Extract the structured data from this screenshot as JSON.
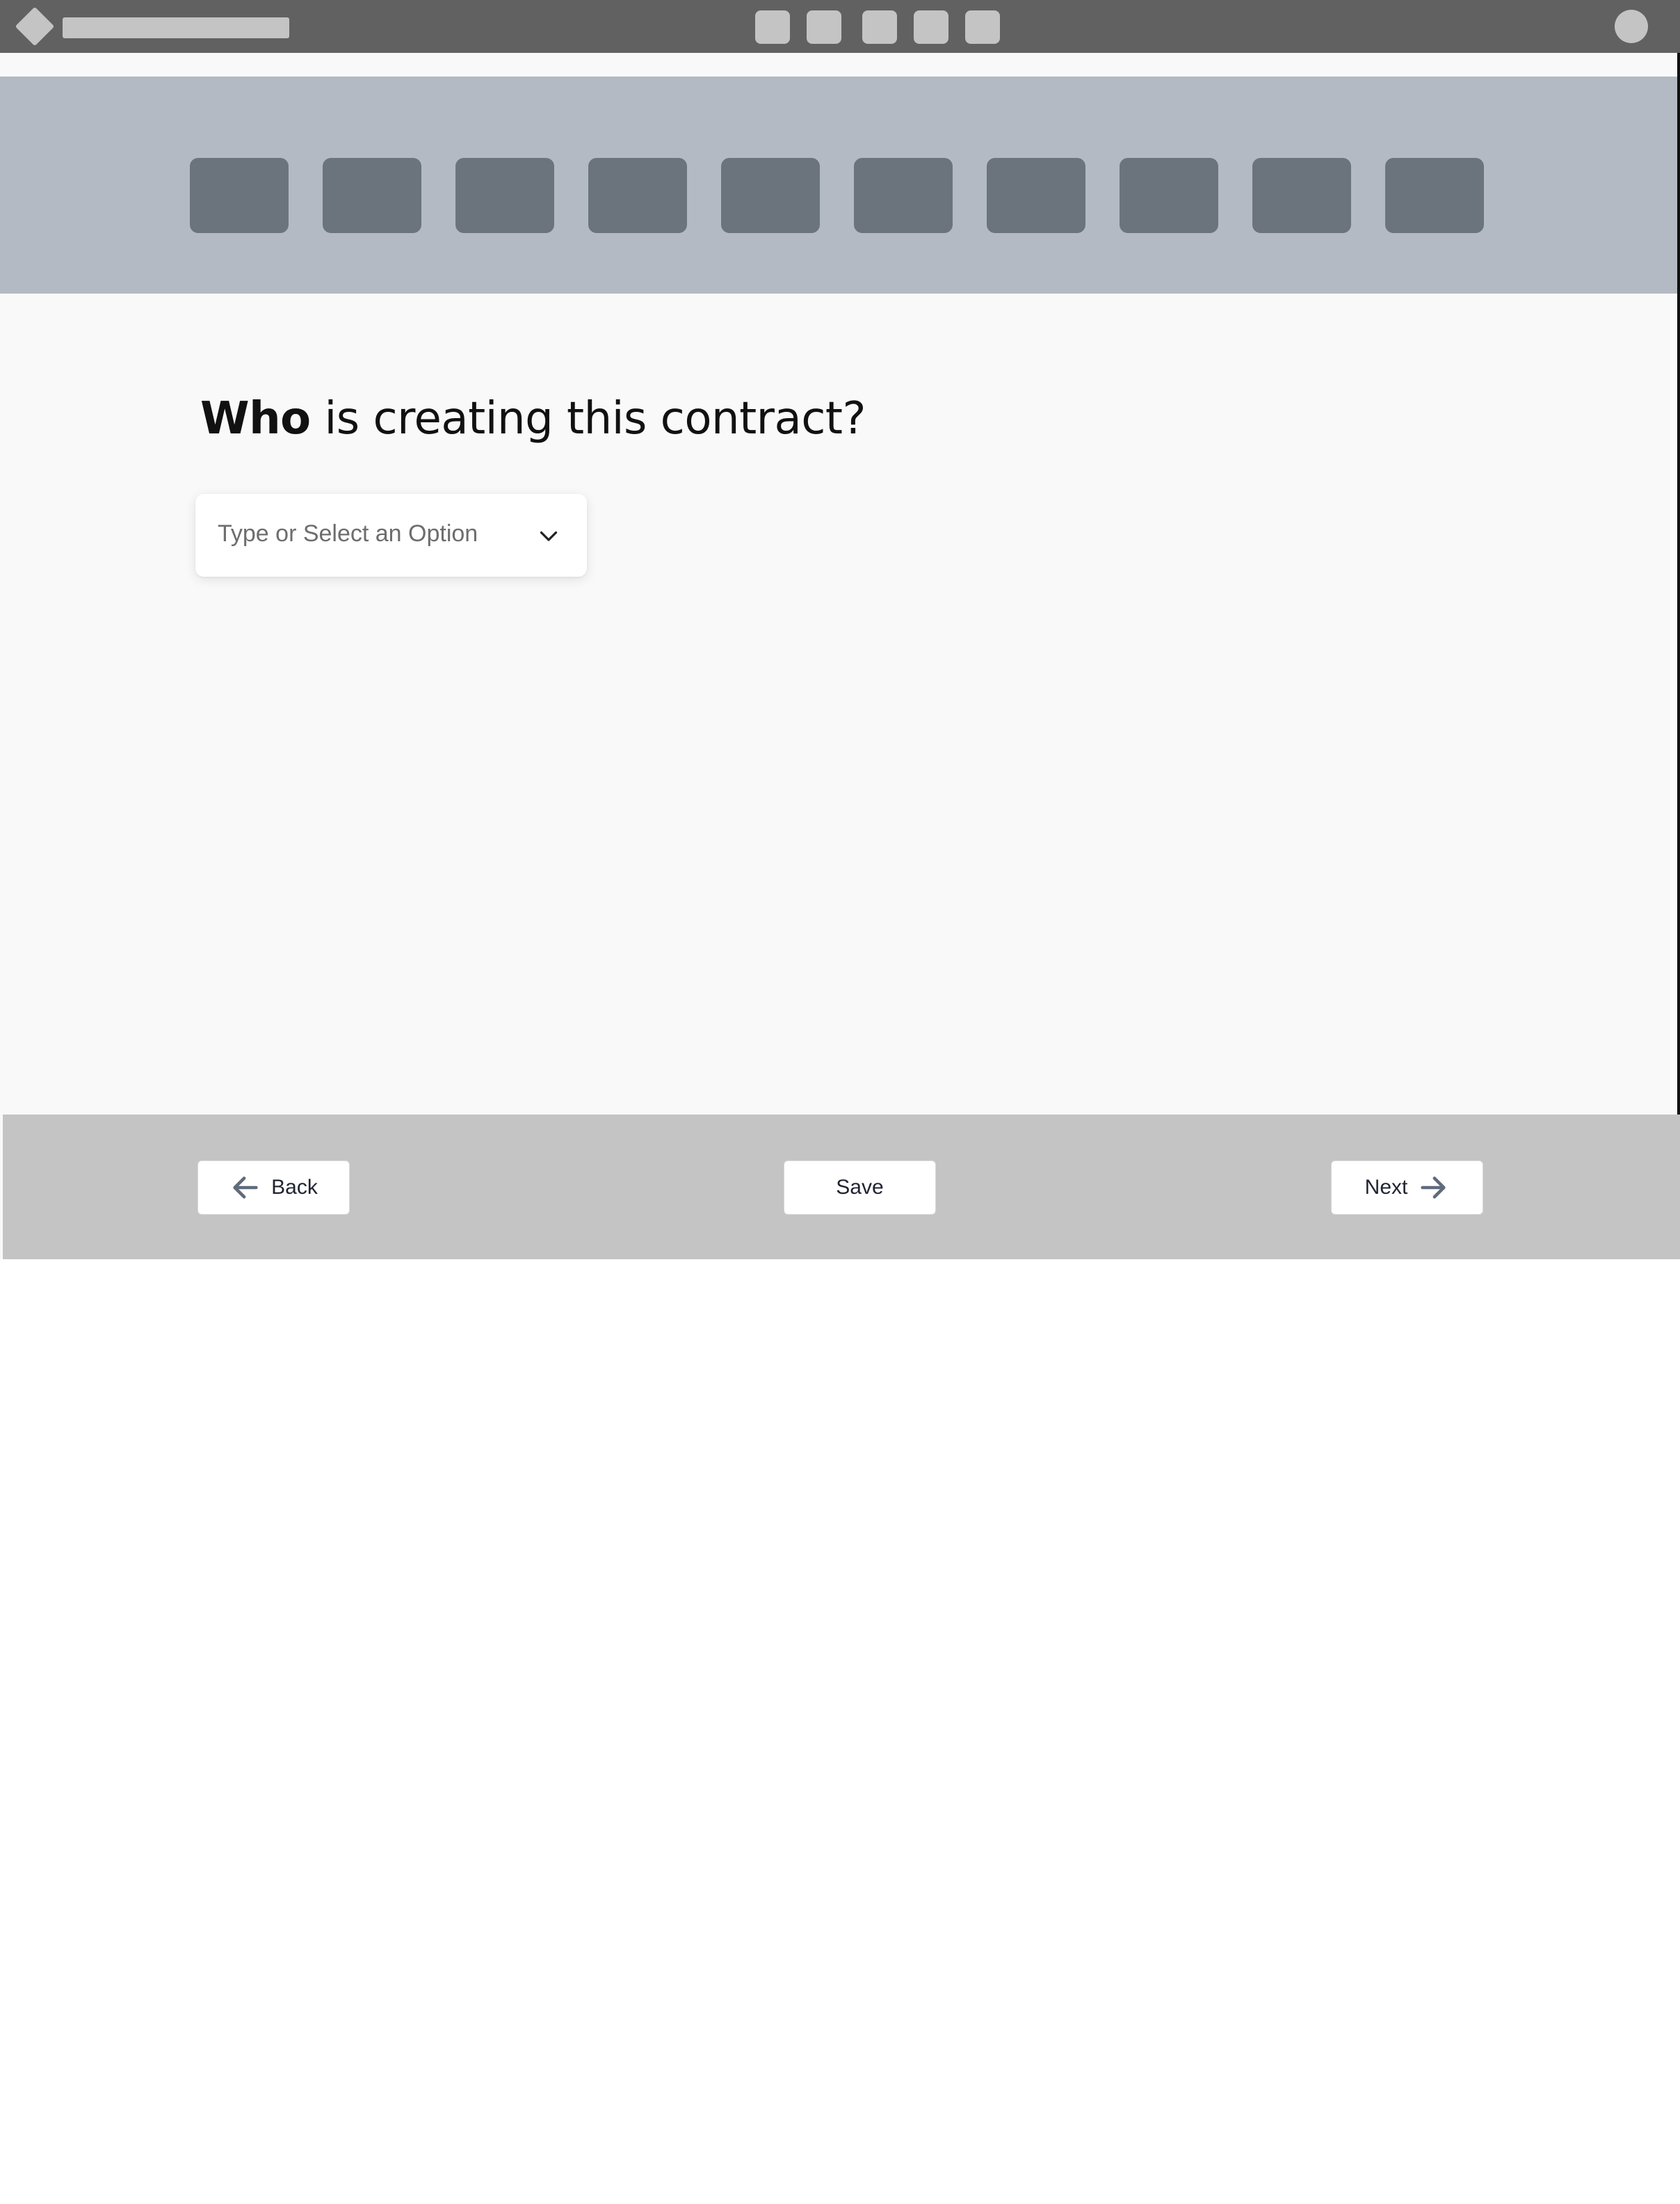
{
  "question": {
    "emphasis": "Who",
    "rest": " is creating this contract?"
  },
  "select": {
    "placeholder": "Type or Select an Option",
    "icon": "chevron-down-icon"
  },
  "footer": {
    "back_label": "Back",
    "save_label": "Save",
    "next_label": "Next"
  },
  "steps": {
    "count": 10
  },
  "colors": {
    "topbar": "#616161",
    "placeholder_gray": "#c4c4c4",
    "steps_band": "#b4bac3",
    "step": "#6b737d",
    "footer": "#c4c4c4",
    "arrow": "#5f6b7a"
  }
}
